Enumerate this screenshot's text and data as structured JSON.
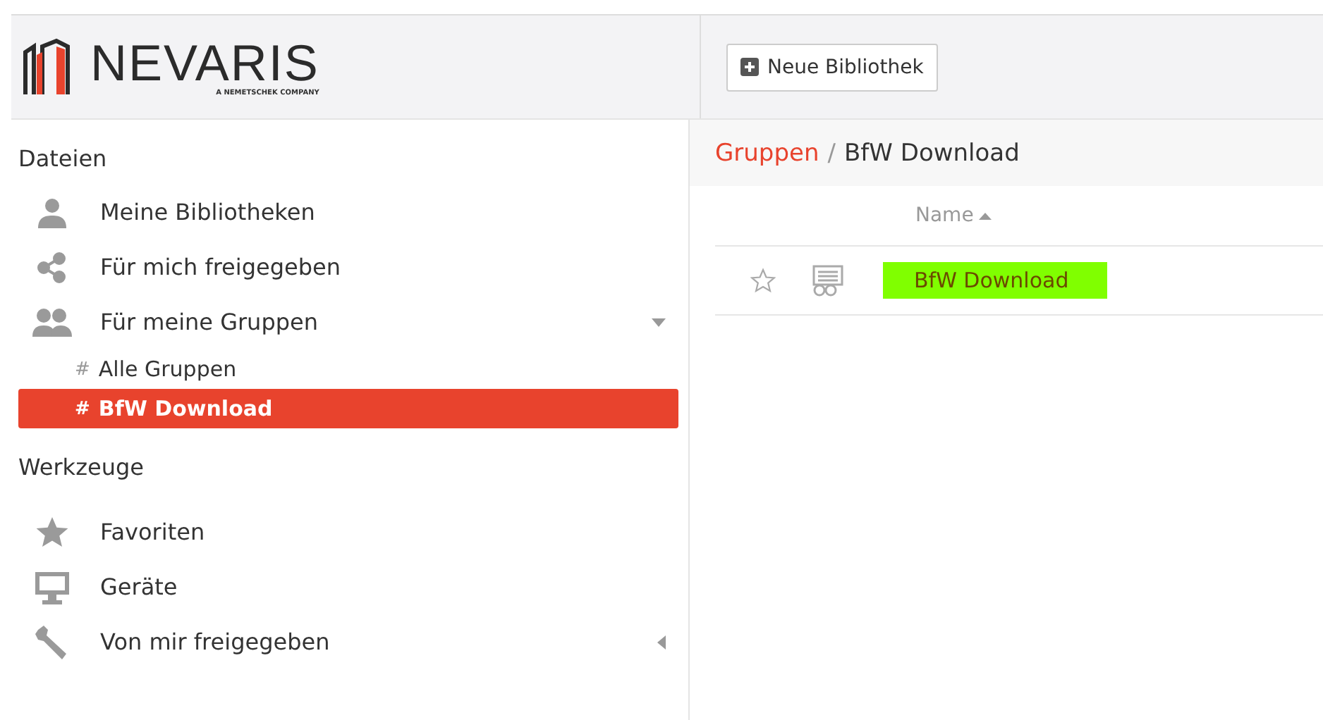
{
  "logo": {
    "name": "NEVARIS",
    "tagline": "A NEMETSCHEK COMPANY"
  },
  "toolbar": {
    "new_library_button": "Neue Bibliothek"
  },
  "sidebar": {
    "sections": [
      {
        "title": "Dateien",
        "items": [
          {
            "label": "Meine Bibliotheken",
            "kind": "person"
          },
          {
            "label": "Für mich freigegeben",
            "kind": "share"
          },
          {
            "label": "Für meine Gruppen",
            "kind": "group",
            "expanded": true,
            "children": [
              {
                "label": "Alle Gruppen",
                "prefix": "#",
                "selected": false
              },
              {
                "label": "BfW Download",
                "prefix": "#",
                "selected": true
              }
            ]
          }
        ]
      },
      {
        "title": "Werkzeuge",
        "items": [
          {
            "label": "Favoriten",
            "kind": "star"
          },
          {
            "label": "Geräte",
            "kind": "monitor"
          },
          {
            "label": "Von mir freigegeben",
            "kind": "wrench",
            "expanded": false
          }
        ]
      }
    ]
  },
  "breadcrumb": {
    "parent": "Gruppen",
    "separator": "/",
    "current": "BfW Download"
  },
  "table": {
    "columns": [
      {
        "label": "Name",
        "sorted_ascending": true
      }
    ],
    "rows": [
      {
        "starred": false,
        "name": "BfW Download",
        "color": "#80ff00"
      }
    ]
  }
}
